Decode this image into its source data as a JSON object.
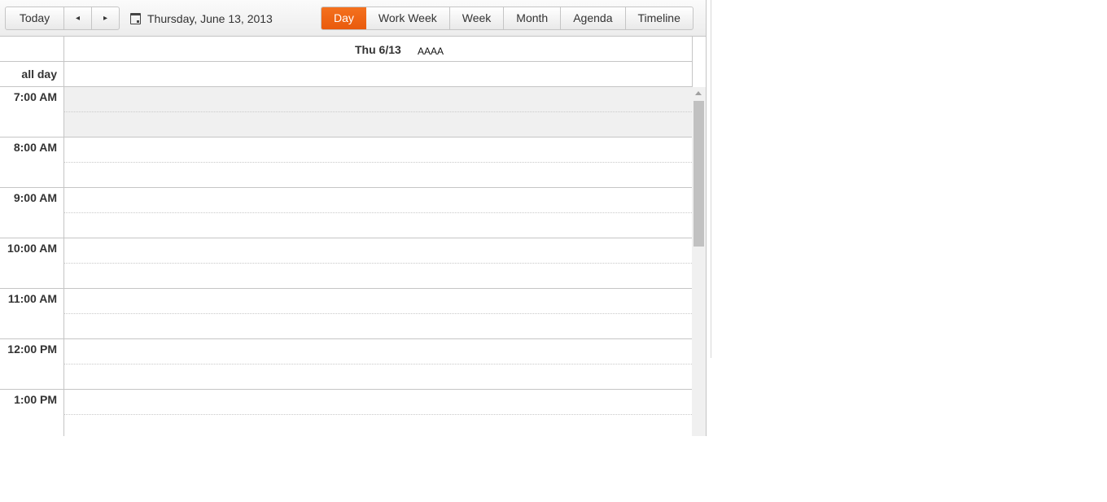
{
  "toolbar": {
    "today_label": "Today",
    "prev_icon": "◂",
    "next_icon": "▸",
    "date_icon": "calendar-icon",
    "date_text": "Thursday, June 13, 2013",
    "views": [
      "Day",
      "Work Week",
      "Week",
      "Month",
      "Agenda",
      "Timeline"
    ],
    "active_view": "Day"
  },
  "header": {
    "day_label": "Thu 6/13",
    "resource_label": "AAAA"
  },
  "all_day_label": "all day",
  "hours": [
    "7:00 AM",
    "8:00 AM",
    "9:00 AM",
    "10:00 AM",
    "11:00 AM",
    "12:00 PM",
    "1:00 PM"
  ],
  "colors": {
    "accent": "#f26b1d",
    "border": "#c5c5c5",
    "nonwork_bg": "#f0f0f0"
  }
}
